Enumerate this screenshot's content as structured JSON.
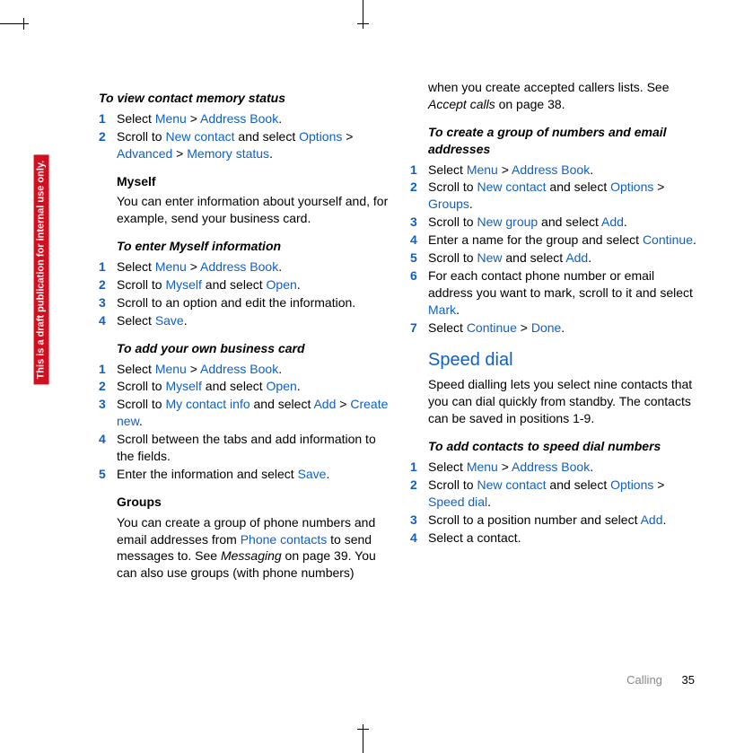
{
  "draft_label": "This is a draft publication for internal use only.",
  "footer": {
    "section": "Calling",
    "page": "35"
  },
  "col1": {
    "h1": "To view contact memory status",
    "s1": {
      "i1": {
        "a": "Select ",
        "b": "Menu",
        "c": " > ",
        "d": "Address Book",
        "e": "."
      },
      "i2": {
        "a": "Scroll to ",
        "b": "New contact",
        "c": " and select ",
        "d": "Options",
        "e": " > ",
        "f": "Advanced",
        "g": " > ",
        "h": "Memory status",
        "i": "."
      }
    },
    "h2": "Myself",
    "p2": "You can enter information about yourself and, for example, send your business card.",
    "h3": "To enter Myself information",
    "s3": {
      "i1": {
        "a": "Select ",
        "b": "Menu",
        "c": " > ",
        "d": "Address Book",
        "e": "."
      },
      "i2": {
        "a": "Scroll to ",
        "b": "Myself",
        "c": " and select ",
        "d": "Open",
        "e": "."
      },
      "i3": "Scroll to an option and edit the information.",
      "i4": {
        "a": "Select ",
        "b": "Save",
        "c": "."
      }
    },
    "h4": "To add your own business card",
    "s4": {
      "i1": {
        "a": "Select ",
        "b": "Menu",
        "c": " > ",
        "d": "Address Book",
        "e": "."
      },
      "i2": {
        "a": "Scroll to ",
        "b": "Myself",
        "c": " and select ",
        "d": "Open",
        "e": "."
      },
      "i3": {
        "a": "Scroll to ",
        "b": "My contact info",
        "c": " and select ",
        "d": "Add",
        "e": " > ",
        "f": "Create new",
        "g": "."
      },
      "i4": "Scroll between the tabs and add information to the fields.",
      "i5": {
        "a": "Enter the information and select ",
        "b": "Save",
        "c": "."
      }
    },
    "h5": "Groups",
    "p5": {
      "a": "You can create a group of phone numbers and email addresses from ",
      "b": "Phone contacts",
      "c": " to send messages to. See ",
      "d": "Messaging",
      "e": " on page 39. You can also use groups (with phone numbers) "
    }
  },
  "col2": {
    "p0": {
      "a": "when you create accepted callers lists. See ",
      "b": "Accept calls",
      "c": " on page 38."
    },
    "h1": "To create a group of numbers and email addresses",
    "s1": {
      "i1": {
        "a": "Select ",
        "b": "Menu",
        "c": " > ",
        "d": "Address Book",
        "e": "."
      },
      "i2": {
        "a": "Scroll to ",
        "b": "New contact",
        "c": " and select ",
        "d": "Options",
        "e": " > ",
        "f": "Groups",
        "g": "."
      },
      "i3": {
        "a": "Scroll to ",
        "b": "New group",
        "c": " and select ",
        "d": "Add",
        "e": "."
      },
      "i4": {
        "a": "Enter a name for the group and select ",
        "b": "Continue",
        "c": "."
      },
      "i5": {
        "a": "Scroll to ",
        "b": "New",
        "c": " and select ",
        "d": "Add",
        "e": "."
      },
      "i6": {
        "a": "For each contact phone number or email address you want to mark, scroll to it and select ",
        "b": "Mark",
        "c": "."
      },
      "i7": {
        "a": "Select ",
        "b": "Continue",
        "c": " > ",
        "d": "Done",
        "e": "."
      }
    },
    "h2": "Speed dial",
    "p2": "Speed dialling lets you select nine contacts that you can dial quickly from standby. The contacts can be saved in positions 1-9.",
    "h3": "To add contacts to speed dial numbers",
    "s3": {
      "i1": {
        "a": "Select ",
        "b": "Menu",
        "c": " > ",
        "d": "Address Book",
        "e": "."
      },
      "i2": {
        "a": "Scroll to ",
        "b": "New contact",
        "c": " and select ",
        "d": "Options",
        "e": " > ",
        "f": "Speed dial",
        "g": "."
      },
      "i3": {
        "a": "Scroll to a position number and select ",
        "b": "Add",
        "c": "."
      },
      "i4": "Select a contact."
    }
  }
}
